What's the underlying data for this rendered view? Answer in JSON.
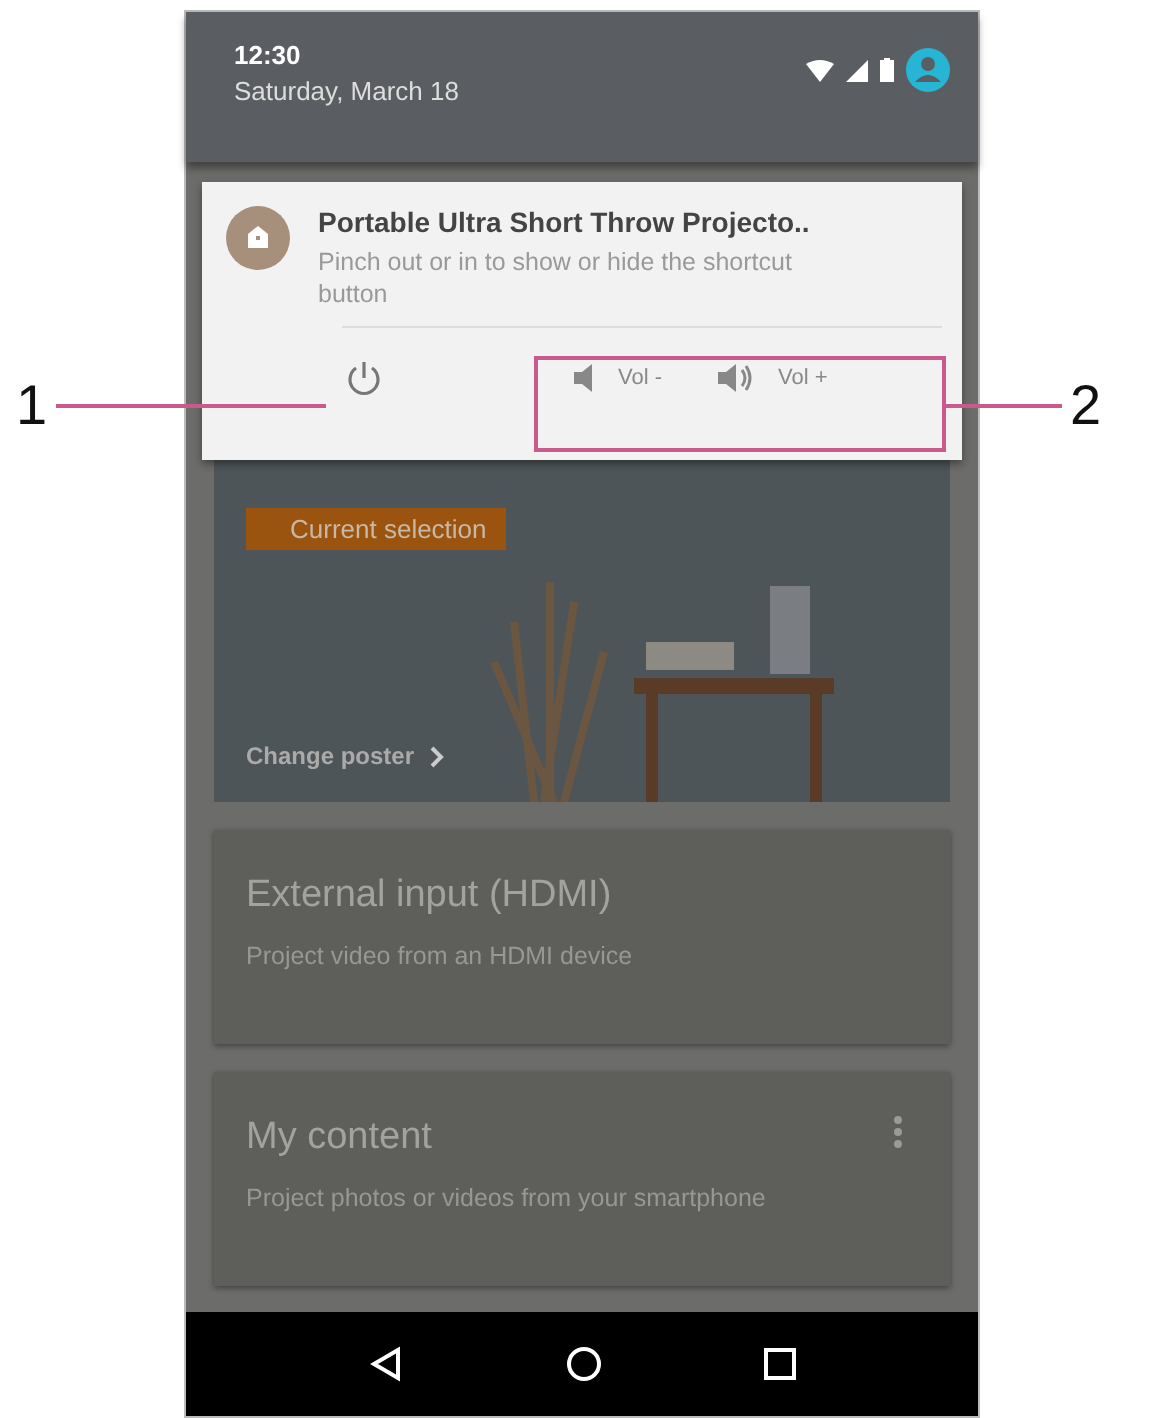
{
  "status_bar": {
    "time": "12:30",
    "date": "Saturday, March 18"
  },
  "notification": {
    "title": "Portable Ultra Short Throw Projecto..",
    "message": "Pinch out or in to show or hide the shortcut button",
    "actions": [
      {
        "kind": "power"
      },
      {
        "kind": "vol_down",
        "label": "Vol -"
      },
      {
        "kind": "vol_up",
        "label": "Vol +"
      }
    ]
  },
  "poster": {
    "badge": "Current selection",
    "link": "Change poster"
  },
  "cards": [
    {
      "title": "External input (HDMI)",
      "subtitle": "Project video from an HDMI device"
    },
    {
      "title": "My content",
      "subtitle": "Project photos or videos from your smartphone"
    }
  ],
  "callouts": [
    {
      "label": "1"
    },
    {
      "label": "2"
    }
  ]
}
